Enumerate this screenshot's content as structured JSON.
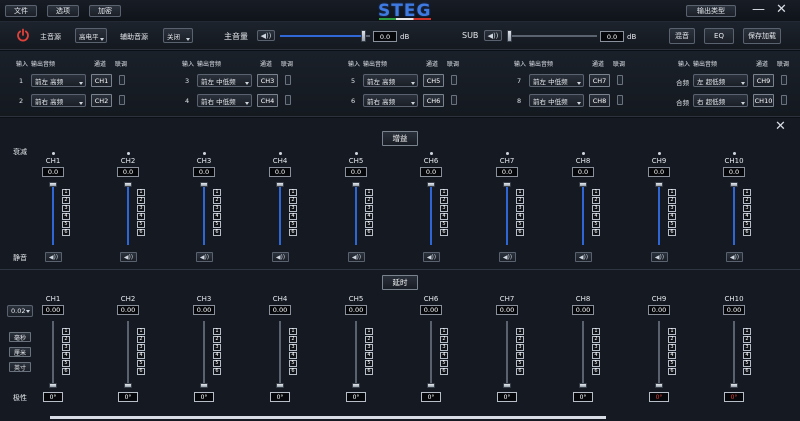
{
  "title_bar": {
    "menu": [
      "文件",
      "选项",
      "加密"
    ],
    "logo": "STEG",
    "output_type_button": "输出类型",
    "minimize": "—",
    "close": "✕"
  },
  "controls": {
    "main_source_label": "主音源",
    "main_source_value": "高电平",
    "aux_source_label": "辅助音源",
    "aux_source_value": "关闭",
    "master_volume_label": "主音量",
    "master_volume_value": "0.0",
    "master_volume_level": 0.95,
    "db_unit": "dB",
    "sub_label": "SUB",
    "sub_value": "0.0",
    "sub_level": 0.0,
    "mix_button": "混音",
    "eq_button": "EQ",
    "save_load_button": "保存加载"
  },
  "routing": {
    "headers": {
      "input": "输入",
      "output_source": "输出音频",
      "channel": "通道",
      "link": "联调"
    },
    "groups": [
      {
        "rows": [
          {
            "input": "1",
            "source": "前左 高频",
            "channel": "CH1"
          },
          {
            "input": "2",
            "source": "前右 高频",
            "channel": "CH2"
          }
        ]
      },
      {
        "rows": [
          {
            "input": "3",
            "source": "前左 中低频",
            "channel": "CH3"
          },
          {
            "input": "4",
            "source": "前右 中低频",
            "channel": "CH4"
          }
        ]
      },
      {
        "rows": [
          {
            "input": "5",
            "source": "前左 高频",
            "channel": "CH5"
          },
          {
            "input": "6",
            "source": "前右 高频",
            "channel": "CH6"
          }
        ]
      },
      {
        "rows": [
          {
            "input": "7",
            "source": "前左 中低频",
            "channel": "CH7"
          },
          {
            "input": "8",
            "source": "前右 中低频",
            "channel": "CH8"
          }
        ]
      },
      {
        "rows": [
          {
            "input": "合频",
            "source": "左 超低频",
            "channel": "CH9"
          },
          {
            "input": "合频",
            "source": "右 超低频",
            "channel": "CH10"
          }
        ]
      }
    ]
  },
  "gain_section": {
    "title": "增益",
    "attenuation_label": "衰减",
    "mute_label": "静音",
    "channels": [
      {
        "name": "CH1",
        "value": "0.0",
        "level": 1.0
      },
      {
        "name": "CH2",
        "value": "0.0",
        "level": 1.0
      },
      {
        "name": "CH3",
        "value": "0.0",
        "level": 1.0
      },
      {
        "name": "CH4",
        "value": "0.0",
        "level": 1.0
      },
      {
        "name": "CH5",
        "value": "0.0",
        "level": 1.0
      },
      {
        "name": "CH6",
        "value": "0.0",
        "level": 1.0
      },
      {
        "name": "CH7",
        "value": "0.0",
        "level": 1.0
      },
      {
        "name": "CH8",
        "value": "0.0",
        "level": 1.0
      },
      {
        "name": "CH9",
        "value": "0.0",
        "level": 1.0
      },
      {
        "name": "CH10",
        "value": "0.0",
        "level": 1.0
      }
    ],
    "presets": [
      "1",
      "2",
      "3",
      "4",
      "5",
      "6"
    ]
  },
  "delay_section": {
    "title": "延时",
    "step_value": "0.02",
    "units": [
      "毫秒",
      "厘米",
      "英寸"
    ],
    "polarity_label": "极性",
    "channels": [
      {
        "name": "CH1",
        "value": "0.00",
        "level": 0.0,
        "polarity": "0°",
        "polarity_red": false
      },
      {
        "name": "CH2",
        "value": "0.00",
        "level": 0.0,
        "polarity": "0°",
        "polarity_red": false
      },
      {
        "name": "CH3",
        "value": "0.00",
        "level": 0.0,
        "polarity": "0°",
        "polarity_red": false
      },
      {
        "name": "CH4",
        "value": "0.00",
        "level": 0.0,
        "polarity": "0°",
        "polarity_red": false
      },
      {
        "name": "CH5",
        "value": "0.00",
        "level": 0.0,
        "polarity": "0°",
        "polarity_red": false
      },
      {
        "name": "CH6",
        "value": "0.00",
        "level": 0.0,
        "polarity": "0°",
        "polarity_red": false
      },
      {
        "name": "CH7",
        "value": "0.00",
        "level": 0.0,
        "polarity": "0°",
        "polarity_red": false
      },
      {
        "name": "CH8",
        "value": "0.00",
        "level": 0.0,
        "polarity": "0°",
        "polarity_red": false
      },
      {
        "name": "CH9",
        "value": "0.00",
        "level": 0.0,
        "polarity": "0°",
        "polarity_red": true
      },
      {
        "name": "CH10",
        "value": "0.00",
        "level": 0.0,
        "polarity": "0°",
        "polarity_red": true
      }
    ],
    "presets": [
      "1",
      "2",
      "3",
      "4",
      "5",
      "6"
    ]
  },
  "colors": {
    "accent": "#3068d8",
    "polarity_alert": "#e0413a"
  }
}
